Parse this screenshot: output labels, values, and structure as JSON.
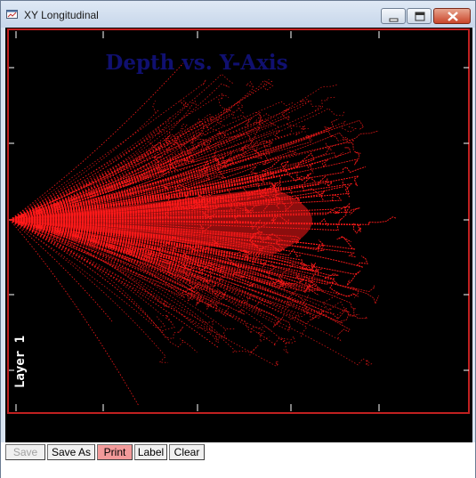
{
  "window": {
    "title": "XY Longitudinal"
  },
  "plot": {
    "title": "Depth vs. Y-Axis",
    "layer_label": "Layer 1",
    "colors": {
      "background": "#000000",
      "border": "#c02020",
      "title": "#101070",
      "traces": "#ff1a1a",
      "ticks": "#ffffff"
    }
  },
  "toolbar": {
    "save_label": "Save",
    "save_as_label": "Save As",
    "print_label": "Print",
    "label_label": "Label",
    "clear_label": "Clear"
  },
  "icons": {
    "app": "chart-window-icon",
    "minimize": "minimize-icon",
    "maximize": "maximize-icon",
    "close": "close-icon"
  }
}
